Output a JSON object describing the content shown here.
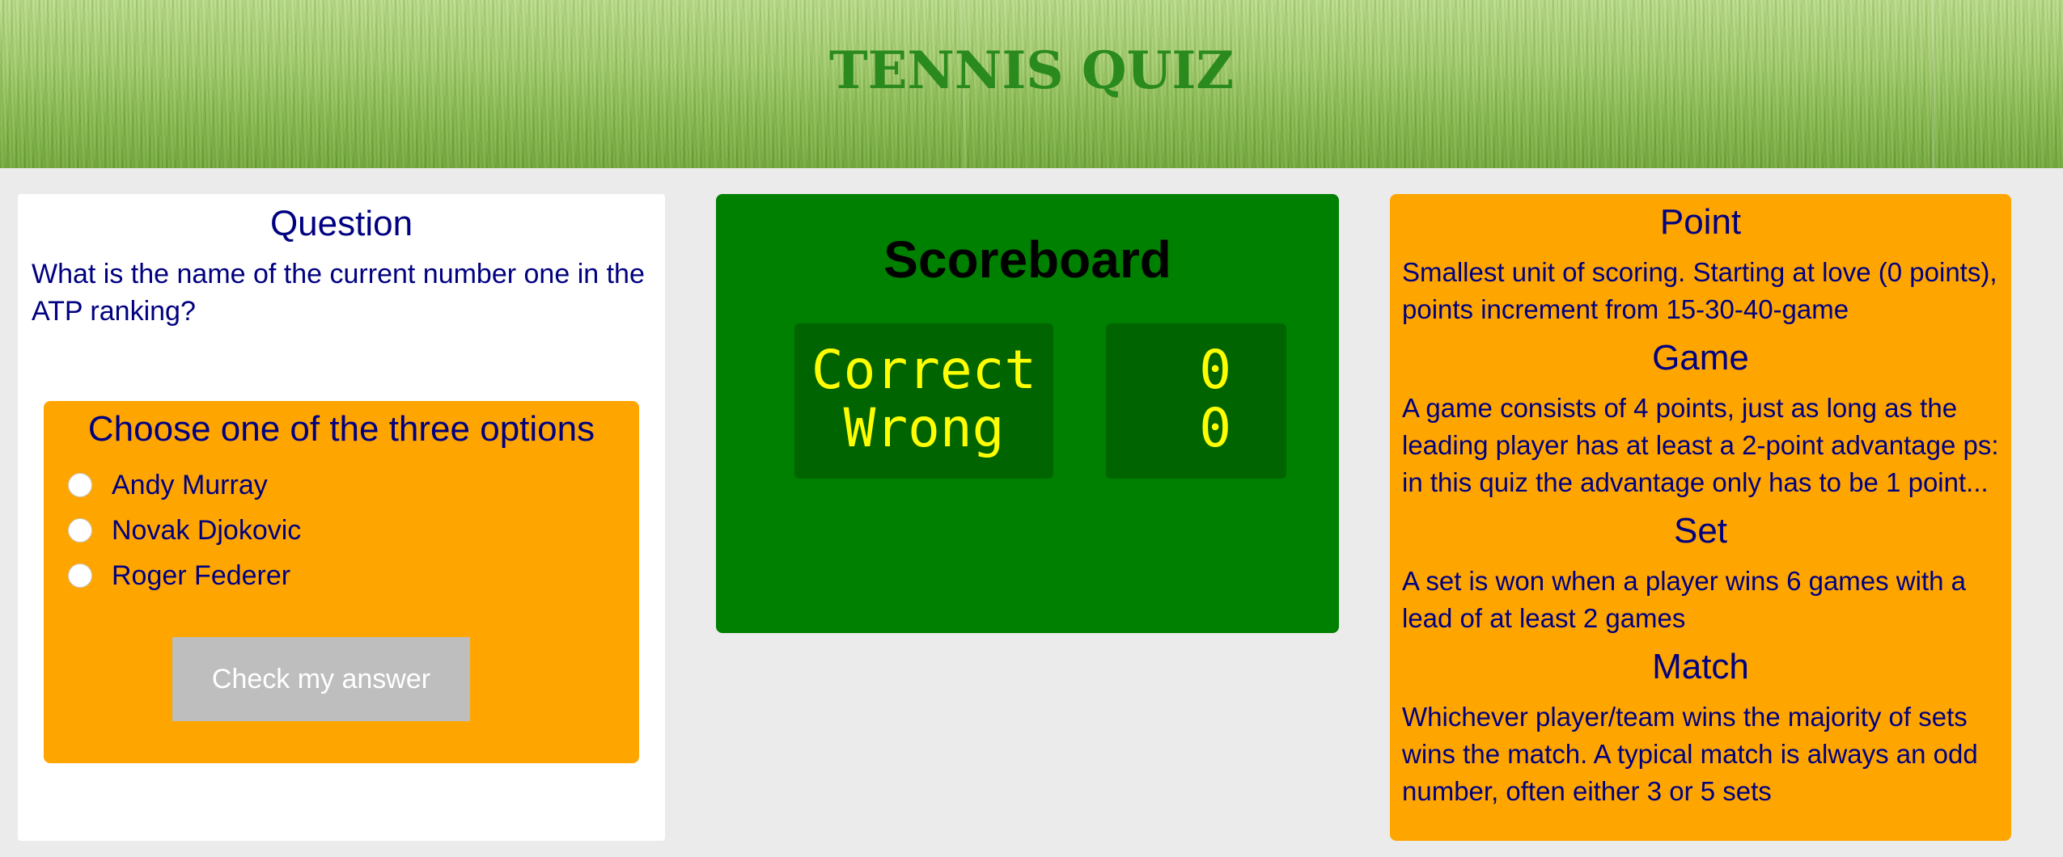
{
  "header": {
    "title": "TENNIS QUIZ"
  },
  "question": {
    "heading": "Question",
    "text": "What is the name of the current number one in the ATP ranking?",
    "options_heading": "Choose one of the three options",
    "options": [
      {
        "label": "Andy Murray",
        "selected": false
      },
      {
        "label": "Novak Djokovic",
        "selected": false
      },
      {
        "label": "Roger Federer",
        "selected": false
      }
    ],
    "submit_label": "Check my answer"
  },
  "scoreboard": {
    "title": "Scoreboard",
    "correct_label": "Correct",
    "wrong_label": "Wrong",
    "correct_value": "0",
    "wrong_value": "0"
  },
  "glossary": [
    {
      "term": "Point",
      "definition": "Smallest unit of scoring. Starting at love (0 points), points increment from 15-30-40-game"
    },
    {
      "term": "Game",
      "definition": "A game consists of 4 points, just as long as the leading player has at least a 2-point advantage ps: in this quiz the advantage only has to be 1 point..."
    },
    {
      "term": "Set",
      "definition": "A set is won when a player wins 6 games with a lead of at least 2 games"
    },
    {
      "term": "Match",
      "definition": "Whichever player/team wins the majority of sets wins the match. A typical match is always an odd number, often either 3 or 5 sets"
    }
  ],
  "colors": {
    "accent_orange": "#ffa500",
    "scoreboard_green": "#008000",
    "scoreboard_dark": "#006400",
    "digit_yellow": "#ffff00",
    "text_navy": "#000080",
    "title_green": "#2a8a1e"
  }
}
